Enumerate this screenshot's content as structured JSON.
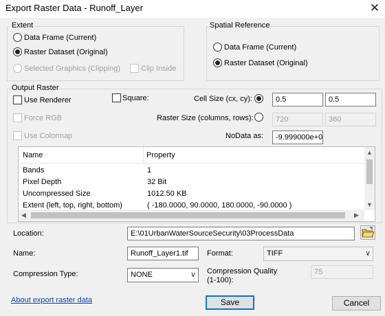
{
  "window": {
    "title": "Export Raster Data - Runoff_Layer",
    "close_glyph": "✕"
  },
  "extent": {
    "label": "Extent",
    "data_frame": "Data Frame (Current)",
    "raster_dataset": "Raster Dataset (Original)",
    "selected_graphics": "Selected Graphics (Clipping)",
    "clip_inside": "Clip Inside"
  },
  "spatial_reference": {
    "label": "Spatial Reference",
    "data_frame": "Data Frame (Current)",
    "raster_dataset": "Raster Dataset (Original)"
  },
  "output_raster": {
    "label": "Output Raster",
    "use_renderer": "Use Renderer",
    "square": "Square:",
    "cell_size_label": "Cell Size (cx, cy):",
    "cell_size_x": "0.5",
    "cell_size_y": "0.5",
    "force_rgb": "Force RGB",
    "raster_size_label": "Raster Size (columns, rows):",
    "columns": "720",
    "rows": "360",
    "use_colormap": "Use Colormap",
    "nodata_label": "NoData as:",
    "nodata_value": "-9.999000e+0"
  },
  "properties": {
    "headers": [
      "Name",
      "Property"
    ],
    "rows": [
      [
        "Bands",
        "1"
      ],
      [
        "Pixel Depth",
        "32 Bit"
      ],
      [
        "Uncompressed Size",
        "1012.50 KB"
      ],
      [
        "Extent (left, top, right, bottom)",
        "( -180.0000, 90.0000, 180.0000, -90.0000 )"
      ]
    ]
  },
  "location": {
    "label": "Location:",
    "value": "E:\\01UrbanWaterSourceSecurity\\03ProcessData"
  },
  "name": {
    "label": "Name:",
    "value": "Runoff_Layer1.tif"
  },
  "format": {
    "label": "Format:",
    "value": "TIFF"
  },
  "compression": {
    "type_label": "Compression Type:",
    "type_value": "NONE",
    "quality_label_line1": "Compression Quality",
    "quality_label_line2": "(1-100):",
    "quality_value": "75"
  },
  "footer": {
    "help_link": "About export raster data",
    "save": "Save",
    "cancel": "Cancel"
  },
  "icons": {
    "folder": "folder-open-icon",
    "chevron": "chevron-down-icon"
  }
}
